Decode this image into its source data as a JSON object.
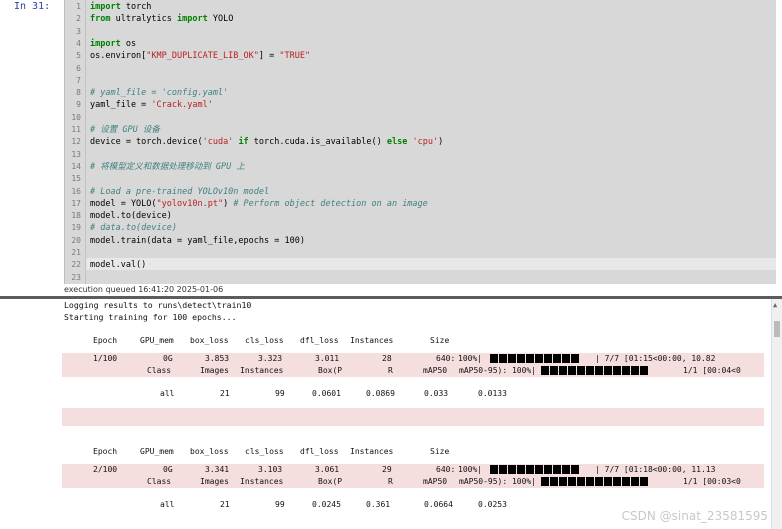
{
  "cell": {
    "prompt": "In  31:",
    "line_numbers": [
      "1",
      "2",
      "3",
      "4",
      "5",
      "6",
      "7",
      "8",
      "9",
      "10",
      "11",
      "12",
      "13",
      "14",
      "15",
      "16",
      "17",
      "18",
      "19",
      "20",
      "21",
      "22",
      "23"
    ],
    "lines": [
      "import torch",
      "from ultralytics import YOLO",
      "",
      "import os",
      "os.environ[\"KMP_DUPLICATE_LIB_OK\"] = \"TRUE\"",
      "",
      "",
      "# yaml_file = 'config.yaml'",
      "yaml_file = 'Crack.yaml'",
      "",
      "# 设置 GPU 设备",
      "device = torch.device('cuda' if torch.cuda.is_available() else 'cpu')",
      "",
      "# 将模型定义和数据处理移动到 GPU 上",
      "",
      "# Load a pre-trained YOLOv10n model",
      "model = YOLO(\"yolov10n.pt\") # Perform object detection on an image",
      "model.to(device)",
      "# data.to(device)",
      "model.train(data = yaml_file,epochs = 100)",
      "",
      "model.val()",
      ""
    ],
    "status": "execution queued 16:41:20 2025-01-06"
  },
  "output": {
    "log1": "Logging results to runs\\detect\\train10",
    "log2": "Starting training for 100 epochs...",
    "headers": [
      "Epoch",
      "GPU_mem",
      "box_loss",
      "cls_loss",
      "dfl_loss",
      "Instances",
      "Size"
    ],
    "epochs": [
      {
        "row1": [
          "1/100",
          "0G",
          "3.853",
          "3.323",
          "3.011",
          "28",
          "640:",
          "100%|",
          "| 7/7 [01:15<00:00, 10.82"
        ],
        "row2": [
          "Class",
          "Images",
          "Instances",
          "Box(P",
          "R",
          "mAP50",
          "mAP50-95): 100%|",
          "1/1 [00:04<0"
        ],
        "row3": [
          "all",
          "21",
          "99",
          "0.0601",
          "0.0869",
          "0.033",
          "0.0133"
        ]
      },
      {
        "row1": [
          "2/100",
          "0G",
          "3.341",
          "3.103",
          "3.061",
          "29",
          "640:",
          "100%|",
          "| 7/7 [01:18<00:00, 11.13"
        ],
        "row2": [
          "Class",
          "Images",
          "Instances",
          "Box(P",
          "R",
          "mAP50",
          "mAP50-95): 100%|",
          "1/1 [00:03<0"
        ],
        "row3": [
          "all",
          "21",
          "99",
          "0.0245",
          "0.361",
          "0.0664",
          "0.0253"
        ]
      }
    ]
  },
  "watermark": "CSDN @sinat_23581595",
  "colors": {
    "stderr_bg": "#f5dede",
    "editor_bg": "#d8d8d8"
  }
}
